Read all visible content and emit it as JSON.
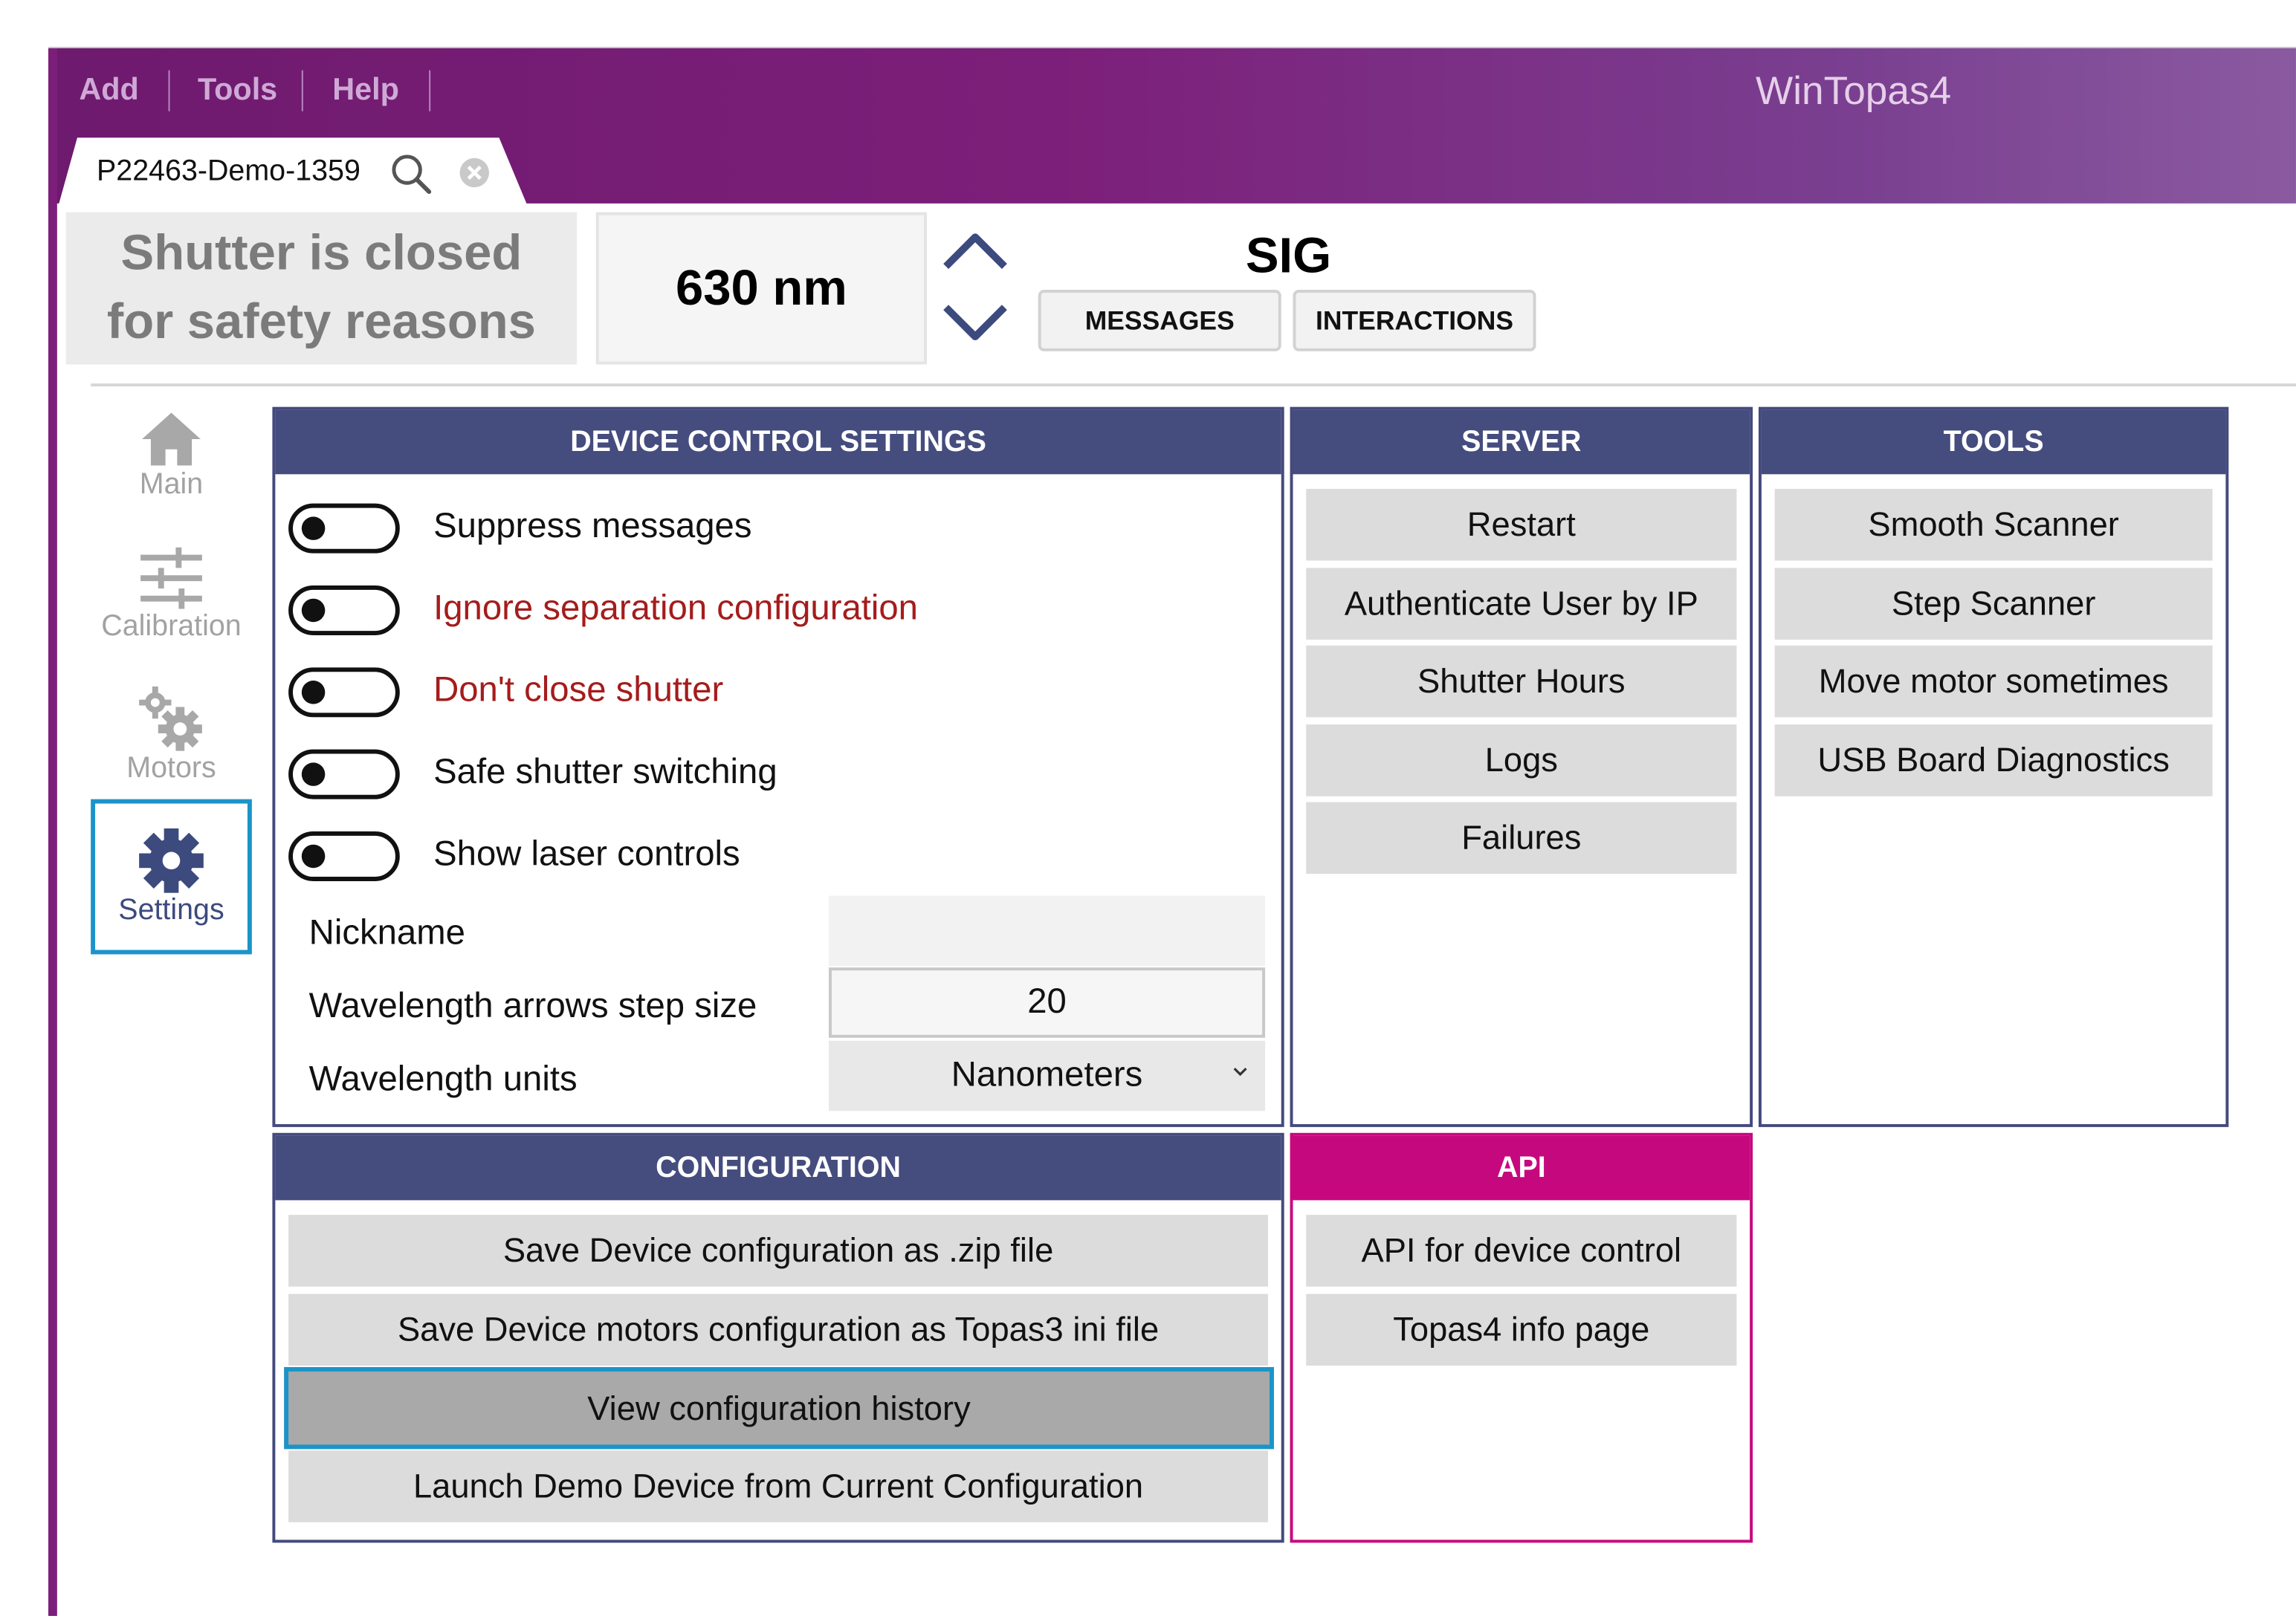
{
  "window": {
    "title": "WinTopas4"
  },
  "menu": {
    "items": [
      "Add",
      "Tools",
      "Help"
    ]
  },
  "tab": {
    "label": "P22463-Demo-1359"
  },
  "header": {
    "shutter_line1": "Shutter is closed",
    "shutter_line2": "for safety reasons",
    "wavelength": "630 nm",
    "sig": "SIG",
    "messages_label": "MESSAGES",
    "interactions_label": "INTERACTIONS"
  },
  "nav": {
    "items": [
      {
        "label": "Main",
        "icon": "home-icon"
      },
      {
        "label": "Calibration",
        "icon": "sliders-icon"
      },
      {
        "label": "Motors",
        "icon": "gears-icon"
      },
      {
        "label": "Settings",
        "icon": "gear-icon",
        "selected": true
      }
    ]
  },
  "device_control": {
    "title": "DEVICE CONTROL SETTINGS",
    "toggles": [
      {
        "label": "Suppress messages",
        "on": false
      },
      {
        "label": "Ignore separation configuration",
        "on": false
      },
      {
        "label": "Don't close shutter",
        "on": false
      },
      {
        "label": "Safe shutter switching",
        "on": false
      },
      {
        "label": "Show laser controls",
        "on": false
      }
    ],
    "nickname_label": "Nickname",
    "nickname_value": "",
    "step_label": "Wavelength arrows step size",
    "step_value": "20",
    "units_label": "Wavelength units",
    "units_value": "Nanometers"
  },
  "server": {
    "title": "SERVER",
    "buttons": [
      "Restart",
      "Authenticate User by IP",
      "Shutter Hours",
      "Logs",
      "Failures"
    ]
  },
  "tools": {
    "title": "TOOLS",
    "buttons": [
      "Smooth Scanner",
      "Step Scanner",
      "Move motor sometimes",
      "USB Board Diagnostics"
    ]
  },
  "configuration": {
    "title": "CONFIGURATION",
    "buttons": [
      "Save Device configuration as .zip file",
      "Save Device motors configuration as Topas3 ini file",
      "View configuration history",
      "Launch Demo Device from Current Configuration"
    ]
  },
  "api": {
    "title": "API",
    "buttons": [
      "API for device control",
      "Topas4 info page"
    ]
  },
  "colors": {
    "title_bar": "#7c1f7a",
    "panel_header": "#454c7e",
    "api_header": "#c6087e",
    "focus_outline": "#1b94c9",
    "warning_text": "#a51c1c"
  }
}
